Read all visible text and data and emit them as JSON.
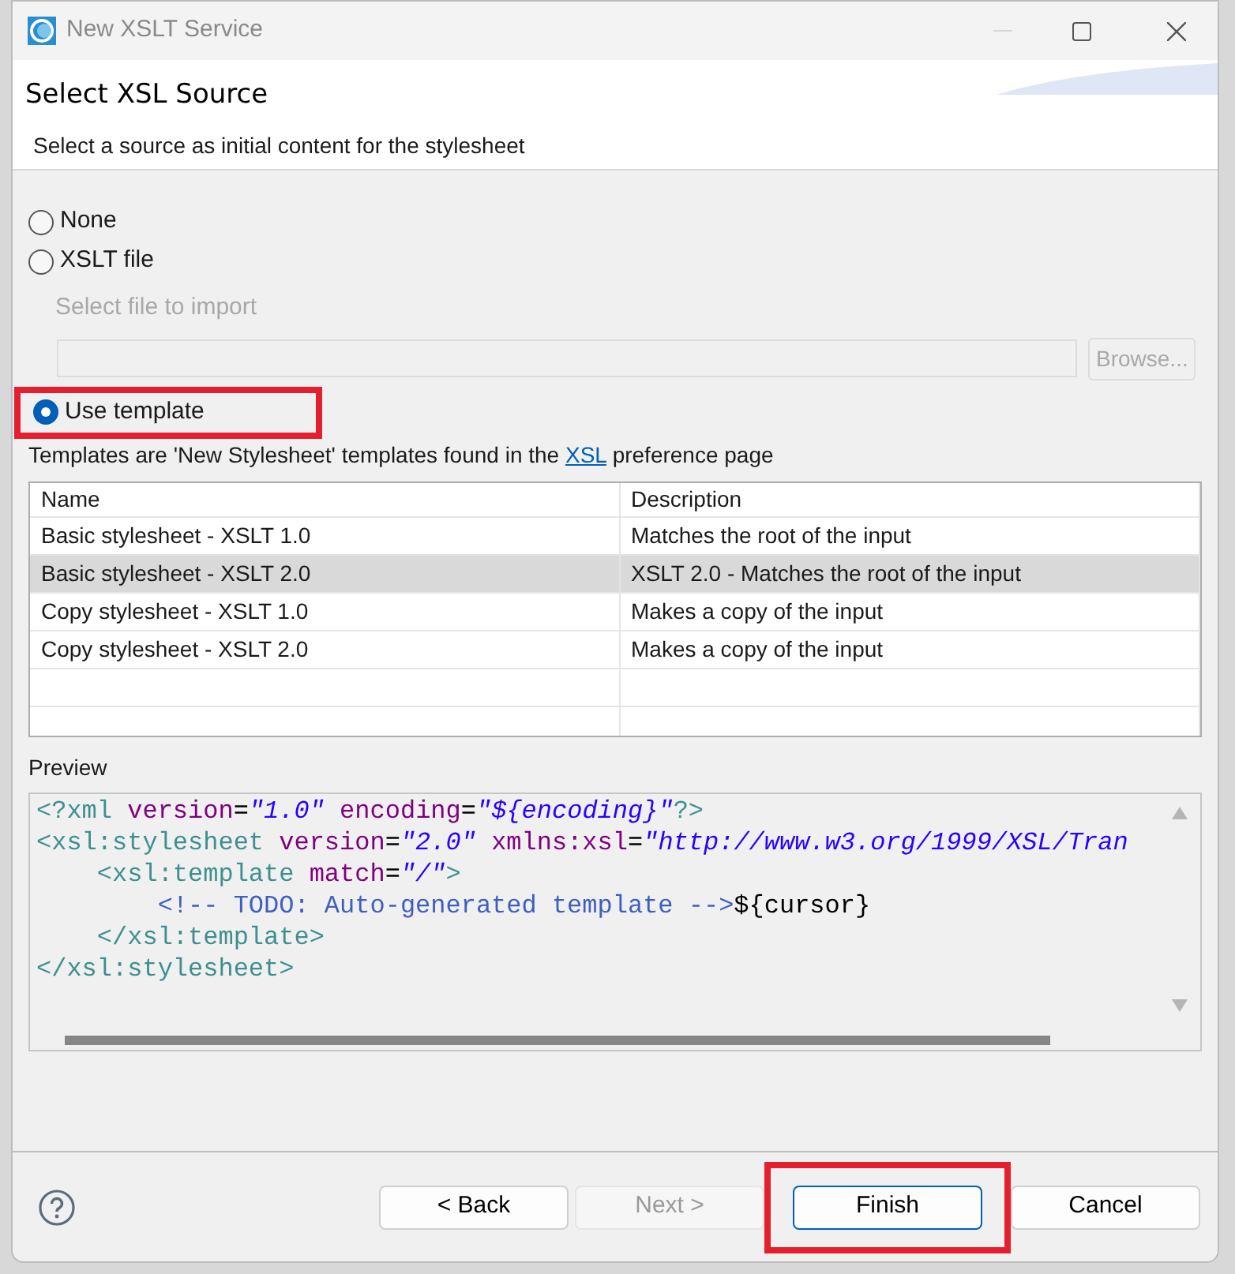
{
  "window": {
    "title": "New XSLT Service"
  },
  "header": {
    "title": "Select XSL Source",
    "description": "Select a source as initial content for the stylesheet"
  },
  "sources": [
    {
      "kind": "radio",
      "label": "None",
      "selected": false,
      "highlighted": false
    },
    {
      "kind": "radio",
      "label": "XSLT file",
      "selected": false,
      "highlighted": false
    },
    {
      "kind": "file",
      "label": "Select file to import",
      "button": "Browse...",
      "disabled": true
    },
    {
      "kind": "radio",
      "label": "Use template",
      "selected": true,
      "highlighted": true
    }
  ],
  "templates_note": {
    "before": "Templates are 'New Stylesheet' templates found in the ",
    "link": "XSL",
    "after": " preference page"
  },
  "table": {
    "columns": [
      "Name",
      "Description"
    ],
    "rows": [
      {
        "name": "Basic stylesheet - XSLT 1.0",
        "description": "Matches the root of the input",
        "selected": false
      },
      {
        "name": "Basic stylesheet - XSLT 2.0",
        "description": "XSLT 2.0 - Matches the root of the input",
        "selected": true
      },
      {
        "name": "Copy stylesheet - XSLT 1.0",
        "description": "Makes a copy of the input",
        "selected": false
      },
      {
        "name": "Copy stylesheet - XSLT 2.0",
        "description": "Makes a copy of the input",
        "selected": false
      }
    ]
  },
  "preview": {
    "label": "Preview",
    "lines": [
      [
        {
          "kind": "tag",
          "text": "<?xml "
        },
        {
          "kind": "attr",
          "text": "version"
        },
        {
          "kind": "plain",
          "text": "="
        },
        {
          "kind": "value",
          "text": "\"1.0\""
        },
        {
          "kind": "attr",
          "text": " encoding"
        },
        {
          "kind": "plain",
          "text": "="
        },
        {
          "kind": "value",
          "text": "\"${encoding}\""
        },
        {
          "kind": "tag",
          "text": "?>"
        }
      ],
      [
        {
          "kind": "tag",
          "text": "<xsl:stylesheet "
        },
        {
          "kind": "attr",
          "text": "version"
        },
        {
          "kind": "plain",
          "text": "="
        },
        {
          "kind": "value",
          "text": "\"2.0\""
        },
        {
          "kind": "attr",
          "text": " xmlns:xsl"
        },
        {
          "kind": "plain",
          "text": "="
        },
        {
          "kind": "value",
          "text": "\"http://www.w3.org/1999/XSL/Tran"
        }
      ],
      [
        {
          "kind": "tag",
          "text": "    <xsl:template "
        },
        {
          "kind": "attr",
          "text": "match"
        },
        {
          "kind": "plain",
          "text": "="
        },
        {
          "kind": "value",
          "text": "\"/\""
        },
        {
          "kind": "tag",
          "text": ">"
        }
      ],
      [
        {
          "kind": "comment",
          "text": "        <!-- TODO: Auto-generated template -->"
        },
        {
          "kind": "plain",
          "text": "${cursor}"
        }
      ],
      [
        {
          "kind": "tag",
          "text": "    </xsl:template>"
        }
      ],
      [
        {
          "kind": "tag",
          "text": "</xsl:stylesheet>"
        }
      ]
    ]
  },
  "buttons": [
    {
      "label": "< Back",
      "disabled": false,
      "default": false,
      "highlighted": false
    },
    {
      "label": "Next >",
      "disabled": true,
      "default": false,
      "highlighted": false
    },
    {
      "label": "Finish",
      "disabled": false,
      "default": true,
      "highlighted": true
    },
    {
      "label": "Cancel",
      "disabled": false,
      "default": false,
      "highlighted": false
    }
  ]
}
